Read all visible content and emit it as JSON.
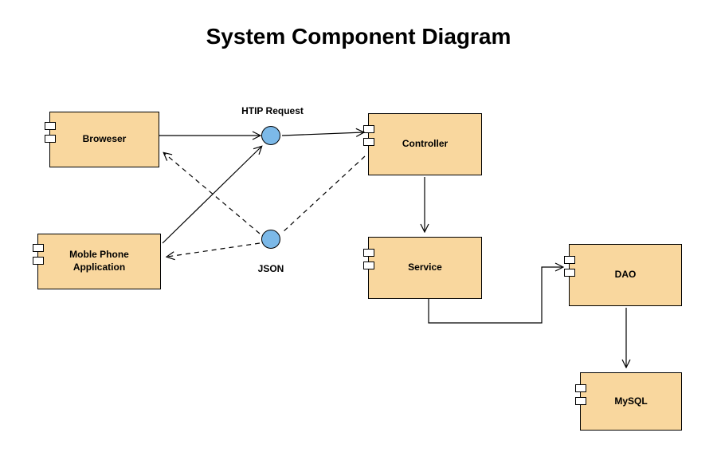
{
  "title": "System Component Diagram",
  "components": {
    "browser": {
      "label": "Broweser"
    },
    "mobile": {
      "label": "Moble Phone\nApplication"
    },
    "controller": {
      "label": "Controller"
    },
    "service": {
      "label": "Service"
    },
    "dao": {
      "label": "DAO"
    },
    "mysql": {
      "label": "MySQL"
    }
  },
  "interfaces": {
    "http": {
      "label": "HTIP Request"
    },
    "json": {
      "label": "JSON"
    }
  }
}
